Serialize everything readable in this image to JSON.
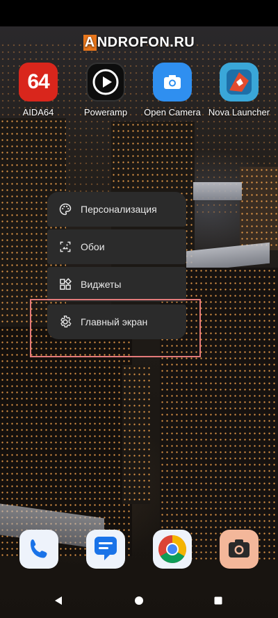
{
  "watermark": {
    "first": "A",
    "rest": "NDROFON.RU"
  },
  "apps": [
    {
      "label": "AIDA64",
      "icon": "aida64-icon",
      "color": "#d9261c"
    },
    {
      "label": "Poweramp",
      "icon": "poweramp-icon",
      "color": "#111111"
    },
    {
      "label": "Open Camera",
      "icon": "camera-icon",
      "color": "#2f8ff0"
    },
    {
      "label": "Nova Launcher",
      "icon": "nova-launcher-icon",
      "color": "#e34b2e"
    }
  ],
  "aida_badge": "64",
  "menu": [
    {
      "label": "Персонализация",
      "icon": "palette-icon"
    },
    {
      "label": "Обои",
      "icon": "wallpaper-icon"
    },
    {
      "label": "Виджеты",
      "icon": "widgets-icon"
    },
    {
      "label": "Главный экран",
      "icon": "settings-gear-icon"
    }
  ],
  "dock": [
    {
      "icon": "phone-icon"
    },
    {
      "icon": "messages-icon"
    },
    {
      "icon": "chrome-icon"
    },
    {
      "icon": "camera-app-icon"
    }
  ],
  "colors": {
    "menu_bg": "#2b2b2b",
    "highlight": "#e57b7b",
    "accent": "#e8761c"
  }
}
